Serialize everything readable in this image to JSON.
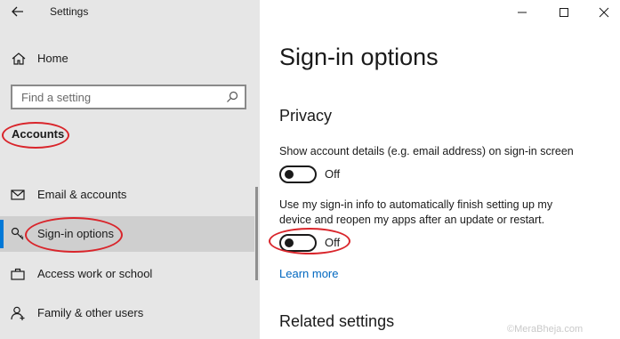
{
  "app": {
    "title": "Settings"
  },
  "sidebar": {
    "home_label": "Home",
    "search_placeholder": "Find a setting",
    "section_title": "Accounts",
    "items": [
      {
        "label": "Email & accounts",
        "icon": "mail-icon"
      },
      {
        "label": "Sign-in options",
        "icon": "key-icon",
        "selected": true
      },
      {
        "label": "Access work or school",
        "icon": "briefcase-icon"
      },
      {
        "label": "Family & other users",
        "icon": "person-icon"
      }
    ]
  },
  "main": {
    "page_title": "Sign-in options",
    "privacy_heading": "Privacy",
    "setting1": {
      "text": "Show account details (e.g. email address) on sign-in screen",
      "state": "Off"
    },
    "setting2": {
      "text": "Use my sign-in info to automatically finish setting up my device and reopen my apps after an update or restart.",
      "state": "Off"
    },
    "learn_more": "Learn more",
    "related_heading": "Related settings"
  },
  "watermark": "©MeraBheja.com",
  "colors": {
    "accent": "#0078d7",
    "annotation": "#d9252b",
    "link": "#0067c0",
    "sidebar_bg": "#e6e6e6"
  }
}
